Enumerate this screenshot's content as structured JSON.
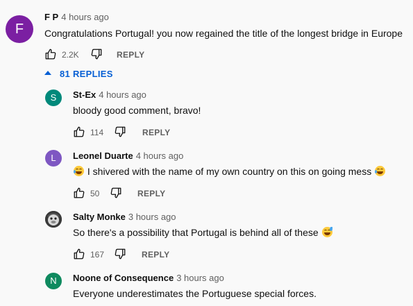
{
  "colors": {
    "background": "#f9f9f9",
    "link_blue": "#065fd4",
    "avatar_fp": "#7b1fa2",
    "avatar_stex": "#00897b",
    "avatar_leonel": "#7e57c2",
    "avatar_noone": "#0f8a5f"
  },
  "main_comment": {
    "avatar_letter": "F",
    "author": "F P",
    "time": "4 hours ago",
    "text": "Congratulations Portugal!  you  now regained the title of the longest bridge in Europe",
    "likes": "2.2K",
    "reply_label": "REPLY"
  },
  "replies_toggle": {
    "label": "81 REPLIES",
    "icon": "caret-up-icon"
  },
  "replies": [
    {
      "avatar_letter": "S",
      "author": "St-Ex",
      "time": "4 hours ago",
      "text": "bloody good comment, bravo!",
      "likes": "114",
      "reply_label": "REPLY"
    },
    {
      "avatar_letter": "L",
      "author": "Leonel Duarte",
      "time": "4 hours ago",
      "text": "I shivered with the name of my own country on this on going mess",
      "likes": "50",
      "reply_label": "REPLY",
      "emoji": "face-with-tears-of-joy"
    },
    {
      "avatar_letter": "",
      "author": "Salty Monke",
      "time": "3 hours ago",
      "text": "So there's a possibility that Portugal is behind all of these",
      "likes": "167",
      "reply_label": "REPLY",
      "emoji": "grinning-face-with-sweat"
    },
    {
      "avatar_letter": "N",
      "author": "Noone of Consequence",
      "time": "3 hours ago",
      "text": "Everyone underestimates the Portuguese special forces.",
      "likes": "",
      "reply_label": ""
    }
  ]
}
